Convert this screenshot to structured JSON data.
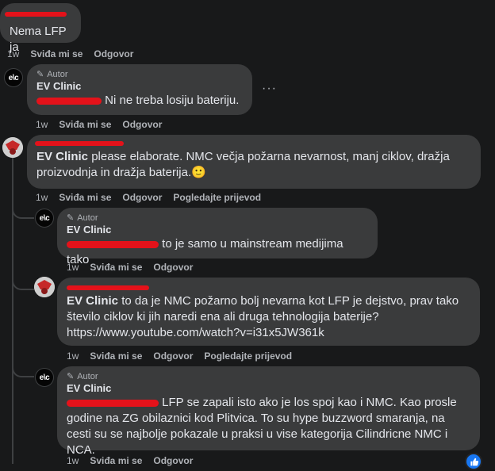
{
  "c1": {
    "text": "Nema LFP ja",
    "time": "1w",
    "like": "Sviđa mi se",
    "reply": "Odgovor"
  },
  "c2": {
    "author_badge": "Autor",
    "name": "EV Clinic",
    "text": "Ni ne treba losiju bateriju.",
    "time": "1w",
    "like": "Sviđa mi se",
    "reply": "Odgovor",
    "more": "···"
  },
  "c3": {
    "mention": "EV Clinic",
    "text": " please elaborate. NMC večja požarna nevarnost, manj ciklov, dražja proizvodnja in dražja baterija.",
    "emoji": "🙂",
    "time": "1w",
    "like": "Sviđa mi se",
    "reply": "Odgovor",
    "translate": "Pogledajte prijevod"
  },
  "c4": {
    "author_badge": "Autor",
    "name": "EV Clinic",
    "text": " to je samo u mainstream medijima tako",
    "time": "1w",
    "like": "Sviđa mi se",
    "reply": "Odgovor"
  },
  "c5": {
    "mention": "EV Clinic",
    "text": " to da je NMC požarno bolj nevarna kot LFP je dejstvo, prav tako število ciklov ki jih naredi ena ali druga tehnologija baterije?",
    "link": "https://www.youtube.com/watch?v=i31x5JW361k",
    "time": "1w",
    "like": "Sviđa mi se",
    "reply": "Odgovor",
    "translate": "Pogledajte prijevod"
  },
  "c6": {
    "author_badge": "Autor",
    "name": "EV Clinic",
    "text": " LFP se zapali isto ako je los spoj kao i NMC. Kao prosle godine na ZG obilaznici kod Plitvica. To su hype buzzword smaranja, na cesti su se najbolje pokazale u praksi u vise kategorija Cilindricne NMC i NCA.",
    "time": "1w",
    "like": "Sviđa mi se",
    "reply": "Odgovor"
  },
  "avatar": {
    "ev_logo": "e\\c"
  },
  "colors": {
    "background": "#18191a",
    "bubble": "#3a3b3c",
    "redaction": "#e4121a",
    "like_badge": "#1877f2"
  }
}
